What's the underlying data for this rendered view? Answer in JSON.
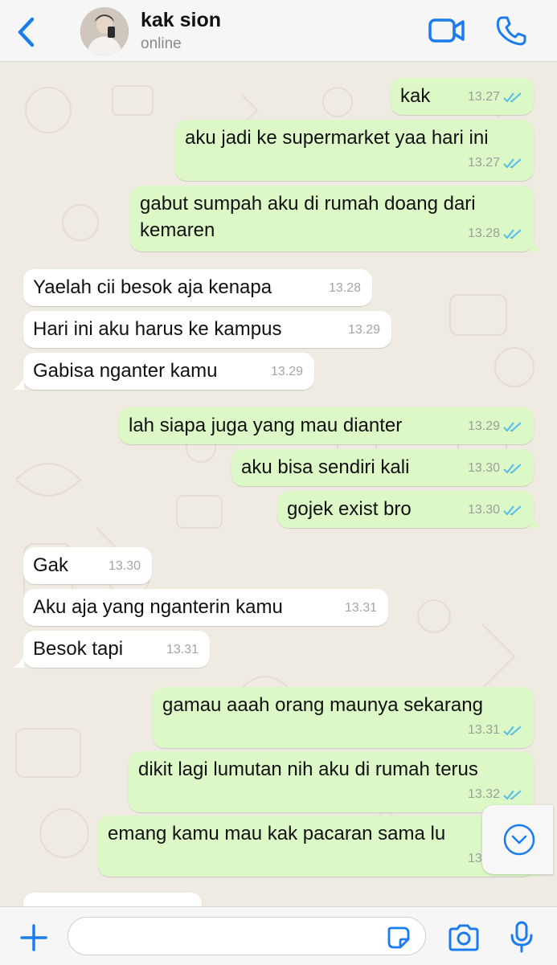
{
  "header": {
    "contact_name": "kak sion",
    "status": "online",
    "icons": {
      "back": "chevron-left-icon",
      "video": "video-camera-icon",
      "call": "phone-icon"
    }
  },
  "messages": [
    {
      "dir": "out",
      "text": "kak",
      "time": "13.27",
      "read": true
    },
    {
      "dir": "out",
      "text": "aku jadi ke supermarket yaa hari ini",
      "time": "13.27",
      "read": true
    },
    {
      "dir": "out",
      "text": "gabut sumpah aku di rumah doang dari kemaren",
      "time": "13.28",
      "read": true
    },
    {
      "dir": "in",
      "text": "Yaelah cii besok aja kenapa",
      "time": "13.28"
    },
    {
      "dir": "in",
      "text": "Hari ini aku harus ke kampus",
      "time": "13.29"
    },
    {
      "dir": "in",
      "text": "Gabisa nganter kamu",
      "time": "13.29"
    },
    {
      "dir": "out",
      "text": "lah siapa juga yang mau dianter",
      "time": "13.29",
      "read": true
    },
    {
      "dir": "out",
      "text": "aku bisa sendiri kali",
      "time": "13.30",
      "read": true
    },
    {
      "dir": "out",
      "text": "gojek exist bro",
      "time": "13.30",
      "read": true
    },
    {
      "dir": "in",
      "text": "Gak",
      "time": "13.30"
    },
    {
      "dir": "in",
      "text": "Aku aja yang nganterin kamu",
      "time": "13.31"
    },
    {
      "dir": "in",
      "text": "Besok tapi",
      "time": "13.31"
    },
    {
      "dir": "out",
      "text": "gamau aaah orang maunya sekarang",
      "time": "13.31",
      "read": true
    },
    {
      "dir": "out",
      "text": "dikit lagi lumutan nih aku di rumah terus",
      "time": "13.32",
      "read": true
    },
    {
      "dir": "out",
      "text": "emang kamu mau kak pacaran sama lu",
      "time": "13.32",
      "read": true
    }
  ],
  "colors": {
    "outgoing_bubble": "#dcf8c6",
    "incoming_bubble": "#ffffff",
    "accent_blue": "#1a7cf0",
    "read_ticks": "#53bdeb"
  },
  "composer": {
    "input_value": "",
    "icons": {
      "attach": "plus-icon",
      "sticker": "sticker-icon",
      "camera": "camera-icon",
      "mic": "microphone-icon"
    }
  },
  "scroll_button_icon": "chevron-down-circle-icon"
}
